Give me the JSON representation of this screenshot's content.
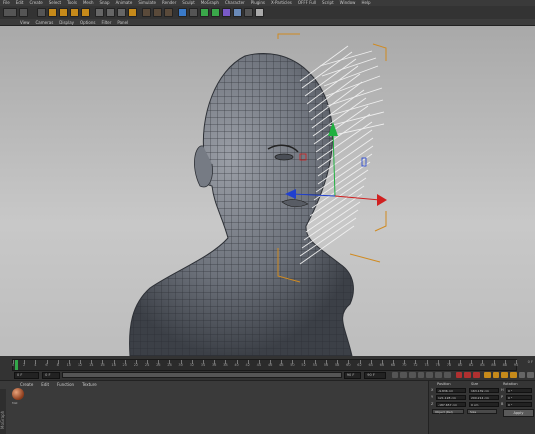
{
  "menubar": {
    "items": [
      "File",
      "Edit",
      "Create",
      "Select",
      "Tools",
      "Mesh",
      "Snap",
      "Animate",
      "Simulate",
      "Render",
      "Sculpt",
      "MoGraph",
      "Character",
      "Plugins",
      "X-Particles",
      "OFFF Full",
      "Script",
      "Window",
      "Help"
    ]
  },
  "viewport_menu": {
    "items": [
      "View",
      "Cameras",
      "Display",
      "Options",
      "Filter",
      "Panel"
    ]
  },
  "timeline": {
    "ticks": [
      "0",
      "2",
      "4",
      "6",
      "8",
      "10",
      "12",
      "14",
      "16",
      "18",
      "20",
      "22",
      "24",
      "26",
      "28",
      "30",
      "32",
      "34",
      "36",
      "38",
      "40",
      "42",
      "44",
      "46",
      "48",
      "50",
      "52",
      "54",
      "56",
      "58",
      "60",
      "62",
      "64",
      "66",
      "68",
      "70",
      "72",
      "74",
      "76",
      "78",
      "80",
      "82",
      "84",
      "86",
      "88",
      "90"
    ],
    "current_frame_field": "0 F",
    "start_field": "0 F",
    "end_field": "90 F",
    "max_field": "90 F",
    "frame_readout": "0 F"
  },
  "material_manager": {
    "tabs": [
      "Create",
      "Edit",
      "Function",
      "Texture"
    ],
    "material_name": "Mat",
    "side_tab": "MoGraph"
  },
  "coordinates": {
    "headers": [
      "Position",
      "Size",
      "Rotation"
    ],
    "rows": [
      {
        "axis": "X",
        "pos": "-9.836 cm",
        "size": "163.139 cm",
        "rot_label": "H",
        "rot": "0 °"
      },
      {
        "axis": "Y",
        "pos": "121.128 cm",
        "size": "200.214 cm",
        "rot_label": "P",
        "rot": "0 °"
      },
      {
        "axis": "Z",
        "pos": "-187.657 cm",
        "size": "0 cm",
        "rot_label": "B",
        "rot": "0 °"
      }
    ],
    "mode_dropdown": "Object (Rel)",
    "size_dropdown": "Size",
    "apply_label": "Apply"
  },
  "colors": {
    "playhead": "#33a64a",
    "guide_orange": "#d08a20",
    "axis_red": "#d02020",
    "axis_green": "#20b040",
    "axis_blue": "#2040d0"
  }
}
